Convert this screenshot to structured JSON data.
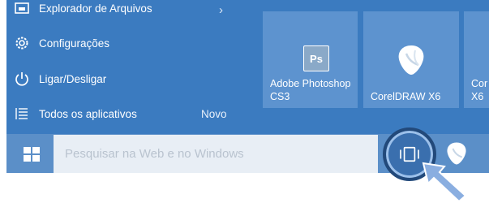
{
  "start_menu": {
    "items": [
      {
        "label": "Explorador de Arquivos",
        "icon": "folder-icon"
      },
      {
        "label": "Configurações",
        "icon": "gear-icon"
      },
      {
        "label": "Ligar/Desligar",
        "icon": "power-icon"
      },
      {
        "label": "Todos os aplicativos",
        "icon": "list-icon",
        "badge": "Novo"
      }
    ]
  },
  "tiles": [
    {
      "label": "Adobe Photoshop CS3",
      "icon_text": "Ps",
      "icon": "photoshop-icon"
    },
    {
      "label": "CorelDRAW X6",
      "icon": "coreldraw-icon"
    },
    {
      "label": "Cor X6",
      "icon": "coreldraw-icon"
    }
  ],
  "taskbar": {
    "search_placeholder": "Pesquisar na Web e no Windows",
    "start_icon": "windows-icon",
    "task_view_icon": "task-view-icon"
  },
  "colors": {
    "start_bg": "#3b7bc0",
    "tile_bg": "#5d93cf",
    "taskbar_bg": "#5b8fc8",
    "search_bg": "#e8eef5"
  }
}
